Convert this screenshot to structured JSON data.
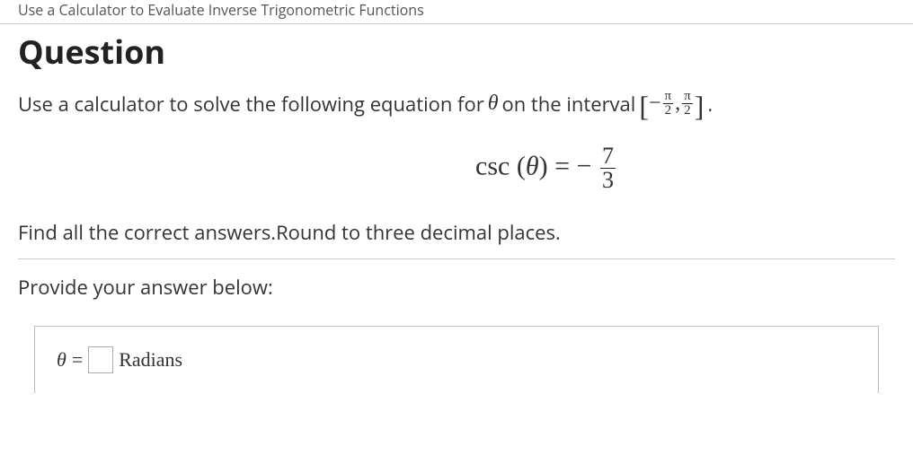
{
  "topic": "Use a Calculator to Evaluate Inverse Trigonometric Functions",
  "heading": "Question",
  "prompt_prefix": "Use a calculator to solve the following equation for ",
  "theta": "θ",
  "prompt_mid": " on the interval ",
  "interval": {
    "open": "[",
    "neg": "−",
    "frac1_num": "π",
    "frac1_den": "2",
    "comma": ",",
    "frac2_num": "π",
    "frac2_den": "2",
    "close": "]"
  },
  "prompt_suffix": " .",
  "equation": {
    "fn": "csc",
    "lparen": "(",
    "arg": "θ",
    "rparen": ")",
    "eq": " = ",
    "neg": "−",
    "num": "7",
    "den": "3"
  },
  "instr2": "Find all the correct answers.Round to three decimal places.",
  "provide": "Provide your answer below:",
  "answer": {
    "theta": "θ",
    "eq": "=",
    "unit": "Radians"
  }
}
